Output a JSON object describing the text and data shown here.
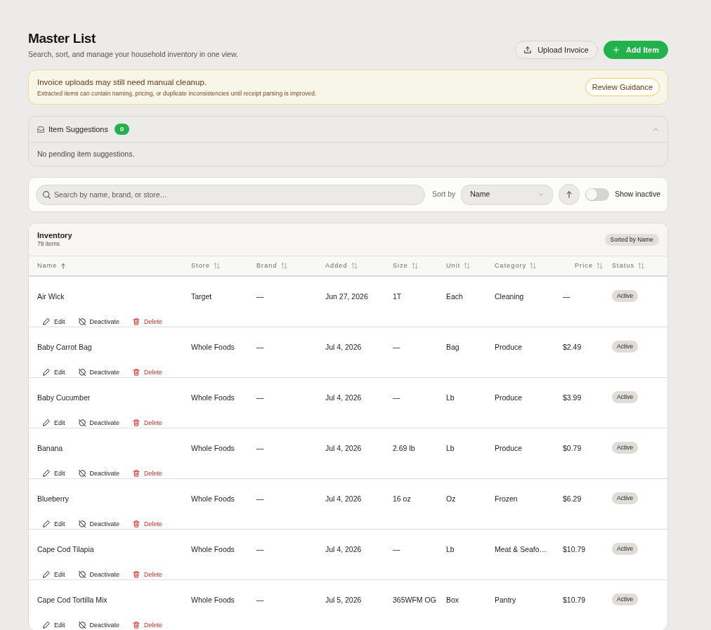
{
  "header": {
    "title": "Master List",
    "subtitle": "Search, sort, and manage your household inventory in one view.",
    "buttons": [
      {
        "label": "Upload Invoice",
        "kind": "upload"
      },
      {
        "label": "Add Item",
        "kind": "add"
      }
    ]
  },
  "alert": {
    "title": "Invoice uploads may still need manual cleanup.",
    "message": "Extracted items can contain naming, pricing, or duplicate inconsistencies until receipt parsing is improved.",
    "button": "Review Guidance"
  },
  "suggestions": {
    "title": "Item Suggestions",
    "count": "0",
    "expanded": true,
    "empty_message": "No pending item suggestions."
  },
  "toolbar": {
    "search": {
      "placeholder": "Search by name, brand, or store…"
    },
    "sort_label": "Sort by",
    "sort_select": {
      "value": "Name"
    },
    "sort_ascending": true,
    "show_inactive": {
      "label": "Show inactive",
      "on": false
    }
  },
  "inventory": {
    "title": "Inventory",
    "count": "79 items",
    "sort_badge": "Sorted by Name",
    "columns": [
      {
        "label": "Name",
        "sorted": true
      },
      {
        "label": "Store",
        "sorted": false
      },
      {
        "label": "Brand",
        "sorted": false
      },
      {
        "label": "Added",
        "sorted": false
      },
      {
        "label": "Size",
        "sorted": false
      },
      {
        "label": "Unit",
        "sorted": false
      },
      {
        "label": "Category",
        "sorted": false
      },
      {
        "label": "Price",
        "sorted": false
      },
      {
        "label": "Status",
        "sorted": false
      }
    ],
    "rows": [
      {
        "cells": [
          "Air Wick",
          "Target",
          "—",
          "Jun 27, 2026",
          "1T",
          "Each",
          "Cleaning",
          "—"
        ],
        "status": "Active",
        "actions": [
          {
            "label": "Edit",
            "kind": "edit"
          },
          {
            "label": "Deactivate",
            "kind": "deactivate"
          },
          {
            "label": "Delete",
            "kind": "delete"
          }
        ]
      },
      {
        "cells": [
          "Baby Carrot Bag",
          "Whole Foods",
          "—",
          "Jul 4, 2026",
          "—",
          "Bag",
          "Produce",
          "$2.49"
        ],
        "status": "Active",
        "actions": [
          {
            "label": "Edit",
            "kind": "edit"
          },
          {
            "label": "Deactivate",
            "kind": "deactivate"
          },
          {
            "label": "Delete",
            "kind": "delete"
          }
        ]
      },
      {
        "cells": [
          "Baby Cucumber",
          "Whole Foods",
          "—",
          "Jul 4, 2026",
          "—",
          "Lb",
          "Produce",
          "$3.99"
        ],
        "status": "Active",
        "actions": [
          {
            "label": "Edit",
            "kind": "edit"
          },
          {
            "label": "Deactivate",
            "kind": "deactivate"
          },
          {
            "label": "Delete",
            "kind": "delete"
          }
        ]
      },
      {
        "cells": [
          "Banana",
          "Whole Foods",
          "—",
          "Jul 4, 2026",
          "2.69 lb",
          "Lb",
          "Produce",
          "$0.79"
        ],
        "status": "Active",
        "actions": [
          {
            "label": "Edit",
            "kind": "edit"
          },
          {
            "label": "Deactivate",
            "kind": "deactivate"
          },
          {
            "label": "Delete",
            "kind": "delete"
          }
        ]
      },
      {
        "cells": [
          "Blueberry",
          "Whole Foods",
          "—",
          "Jul 4, 2026",
          "16 oz",
          "Oz",
          "Frozen",
          "$6.29"
        ],
        "status": "Active",
        "actions": [
          {
            "label": "Edit",
            "kind": "edit"
          },
          {
            "label": "Deactivate",
            "kind": "deactivate"
          },
          {
            "label": "Delete",
            "kind": "delete"
          }
        ]
      },
      {
        "cells": [
          "Cape Cod Tilapia",
          "Whole Foods",
          "—",
          "Jul 4, 2026",
          "—",
          "Lb",
          "Meat & Seafo…",
          "$10.79"
        ],
        "status": "Active",
        "actions": [
          {
            "label": "Edit",
            "kind": "edit"
          },
          {
            "label": "Deactivate",
            "kind": "deactivate"
          },
          {
            "label": "Delete",
            "kind": "delete"
          }
        ]
      },
      {
        "cells": [
          "Cape Cod Tortilla Mix",
          "Whole Foods",
          "—",
          "Jul 5, 2026",
          "365WFM OG",
          "Box",
          "Pantry",
          "$10.79"
        ],
        "status": "Active",
        "actions": [
          {
            "label": "Edit",
            "kind": "edit"
          },
          {
            "label": "Deactivate",
            "kind": "deactivate"
          },
          {
            "label": "Delete",
            "kind": "delete"
          }
        ]
      }
    ]
  }
}
